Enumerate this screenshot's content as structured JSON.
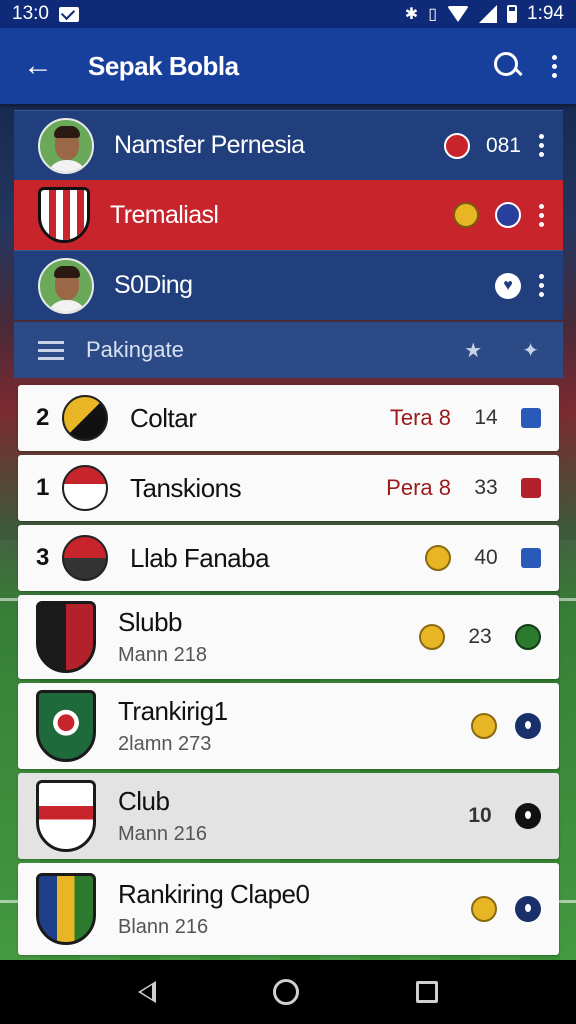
{
  "status_bar": {
    "time_left": "13:0",
    "time_right": "1:94"
  },
  "app_bar": {
    "title": "Sepak Bobla"
  },
  "players": [
    {
      "name": "Namsfer Pernesia",
      "value": "081",
      "variant": "blue"
    },
    {
      "name": "Tremaliasl",
      "value": "",
      "variant": "red"
    },
    {
      "name": "S0Ding",
      "value": "",
      "variant": "blue"
    }
  ],
  "section": {
    "label": "Pakingate"
  },
  "rankings": [
    {
      "pos": "2",
      "name": "Coltar",
      "sub": "",
      "tag": "Tera 8",
      "num": "14"
    },
    {
      "pos": "1",
      "name": "Tanskions",
      "sub": "",
      "tag": "Pera 8",
      "num": "33"
    },
    {
      "pos": "3",
      "name": "Llab Fanaba",
      "sub": "",
      "tag": "",
      "num": "40"
    },
    {
      "pos": "",
      "name": "Slubb",
      "sub": "Mann 218",
      "tag": "",
      "num": "23"
    },
    {
      "pos": "",
      "name": "Trankirig1",
      "sub": "2lamn 273",
      "tag": "",
      "num": ""
    },
    {
      "pos": "",
      "name": "Club",
      "sub": "Mann 216",
      "tag": "",
      "num": "10"
    },
    {
      "pos": "",
      "name": "Rankiring Clape0",
      "sub": "Blann 216",
      "tag": "",
      "num": ""
    }
  ],
  "colors": {
    "app_bar": "#173f9c",
    "red_row": "#c8242b",
    "blue_row": "#203f7c"
  }
}
